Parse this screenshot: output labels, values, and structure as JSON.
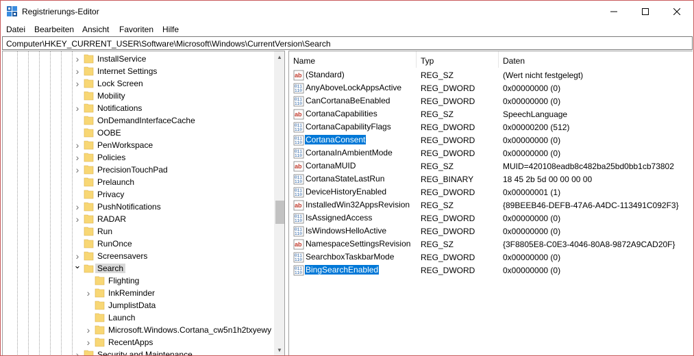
{
  "window": {
    "title": "Registrierungs-Editor",
    "icon": "regedit-icon"
  },
  "menu": [
    "Datei",
    "Bearbeiten",
    "Ansicht",
    "Favoriten",
    "Hilfe"
  ],
  "address": "Computer\\HKEY_CURRENT_USER\\Software\\Microsoft\\Windows\\CurrentVersion\\Search",
  "tree": {
    "items": [
      {
        "label": "InstallService",
        "expandable": true,
        "level": 1
      },
      {
        "label": "Internet Settings",
        "expandable": true,
        "level": 1
      },
      {
        "label": "Lock Screen",
        "expandable": true,
        "level": 1
      },
      {
        "label": "Mobility",
        "expandable": false,
        "level": 1
      },
      {
        "label": "Notifications",
        "expandable": true,
        "level": 1
      },
      {
        "label": "OnDemandInterfaceCache",
        "expandable": false,
        "level": 1
      },
      {
        "label": "OOBE",
        "expandable": false,
        "level": 1
      },
      {
        "label": "PenWorkspace",
        "expandable": true,
        "level": 1
      },
      {
        "label": "Policies",
        "expandable": true,
        "level": 1
      },
      {
        "label": "PrecisionTouchPad",
        "expandable": true,
        "level": 1
      },
      {
        "label": "Prelaunch",
        "expandable": false,
        "level": 1
      },
      {
        "label": "Privacy",
        "expandable": false,
        "level": 1
      },
      {
        "label": "PushNotifications",
        "expandable": true,
        "level": 1
      },
      {
        "label": "RADAR",
        "expandable": true,
        "level": 1
      },
      {
        "label": "Run",
        "expandable": false,
        "level": 1
      },
      {
        "label": "RunOnce",
        "expandable": false,
        "level": 1
      },
      {
        "label": "Screensavers",
        "expandable": true,
        "level": 1
      },
      {
        "label": "Search",
        "expandable": true,
        "expanded": true,
        "selected": true,
        "level": 1
      },
      {
        "label": "Flighting",
        "expandable": false,
        "level": 2
      },
      {
        "label": "InkReminder",
        "expandable": true,
        "level": 2
      },
      {
        "label": "JumplistData",
        "expandable": false,
        "level": 2
      },
      {
        "label": "Launch",
        "expandable": false,
        "level": 2
      },
      {
        "label": "Microsoft.Windows.Cortana_cw5n1h2txyewy",
        "expandable": true,
        "level": 2
      },
      {
        "label": "RecentApps",
        "expandable": true,
        "level": 2
      },
      {
        "label": "Security and Maintenance",
        "expandable": true,
        "level": 1
      }
    ]
  },
  "list": {
    "headers": {
      "name": "Name",
      "type": "Typ",
      "data": "Daten"
    },
    "rows": [
      {
        "icon": "string-value-icon",
        "name": "(Standard)",
        "type": "REG_SZ",
        "data": "(Wert nicht festgelegt)"
      },
      {
        "icon": "binary-value-icon",
        "name": "AnyAboveLockAppsActive",
        "type": "REG_DWORD",
        "data": "0x00000000 (0)"
      },
      {
        "icon": "binary-value-icon",
        "name": "CanCortanaBeEnabled",
        "type": "REG_DWORD",
        "data": "0x00000000 (0)"
      },
      {
        "icon": "string-value-icon",
        "name": "CortanaCapabilities",
        "type": "REG_SZ",
        "data": "SpeechLanguage"
      },
      {
        "icon": "binary-value-icon",
        "name": "CortanaCapabilityFlags",
        "type": "REG_DWORD",
        "data": "0x00000200 (512)"
      },
      {
        "icon": "binary-value-icon",
        "name": "CortanaConsent",
        "type": "REG_DWORD",
        "data": "0x00000000 (0)",
        "selected": true
      },
      {
        "icon": "binary-value-icon",
        "name": "CortanaInAmbientMode",
        "type": "REG_DWORD",
        "data": "0x00000000 (0)"
      },
      {
        "icon": "string-value-icon",
        "name": "CortanaMUID",
        "type": "REG_SZ",
        "data": "MUID=420108eadb8c482ba25bd0bb1cb73802"
      },
      {
        "icon": "binary-value-icon",
        "name": "CortanaStateLastRun",
        "type": "REG_BINARY",
        "data": "18 45 2b 5d 00 00 00 00"
      },
      {
        "icon": "binary-value-icon",
        "name": "DeviceHistoryEnabled",
        "type": "REG_DWORD",
        "data": "0x00000001 (1)"
      },
      {
        "icon": "string-value-icon",
        "name": "InstalledWin32AppsRevision",
        "type": "REG_SZ",
        "data": "{89BEEB46-DEFB-47A6-A4DC-113491C092F3}"
      },
      {
        "icon": "binary-value-icon",
        "name": "IsAssignedAccess",
        "type": "REG_DWORD",
        "data": "0x00000000 (0)"
      },
      {
        "icon": "binary-value-icon",
        "name": "IsWindowsHelloActive",
        "type": "REG_DWORD",
        "data": "0x00000000 (0)"
      },
      {
        "icon": "string-value-icon",
        "name": "NamespaceSettingsRevision",
        "type": "REG_SZ",
        "data": "{3F8805E8-C0E3-4046-80A8-9872A9CAD20F}"
      },
      {
        "icon": "binary-value-icon",
        "name": "SearchboxTaskbarMode",
        "type": "REG_DWORD",
        "data": "0x00000000 (0)"
      },
      {
        "icon": "binary-value-icon",
        "name": "BingSearchEnabled",
        "type": "REG_DWORD",
        "data": "0x00000000 (0)",
        "selected": true
      }
    ]
  },
  "colors": {
    "selection": "#0078d7",
    "folder": "#f8d775",
    "tree_selection": "#d9d9d9"
  }
}
